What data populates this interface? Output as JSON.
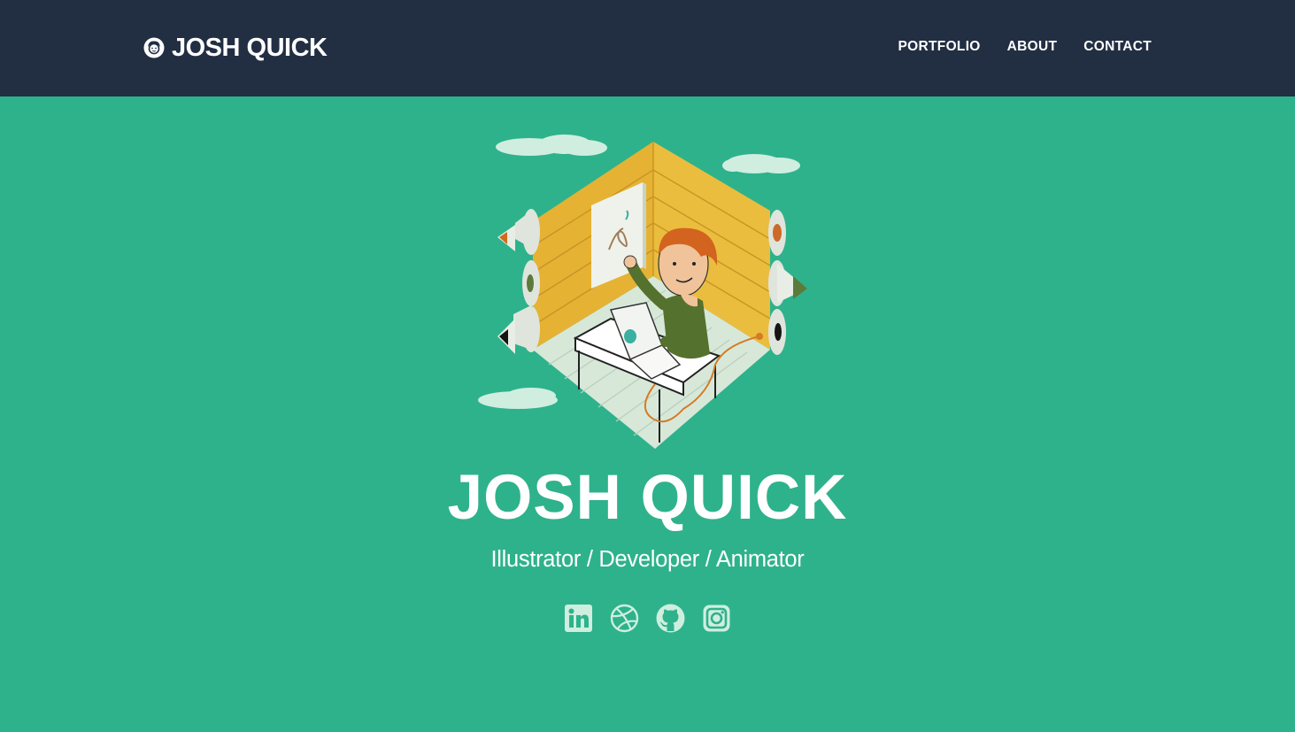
{
  "header": {
    "brand_text": "JOSH QUICK",
    "nav": [
      {
        "label": "PORTFOLIO"
      },
      {
        "label": "ABOUT"
      },
      {
        "label": "CONTACT"
      }
    ]
  },
  "hero": {
    "title": "JOSH QUICK",
    "subtitle": "Illustrator / Developer / Animator"
  },
  "social": [
    {
      "icon": "linkedin-icon"
    },
    {
      "icon": "dribbble-icon"
    },
    {
      "icon": "github-icon"
    },
    {
      "icon": "instagram-icon"
    }
  ],
  "colors": {
    "navbar_bg": "#222e42",
    "page_bg": "#2eb28b",
    "icon_color": "#cfeee0",
    "text": "#ffffff"
  }
}
